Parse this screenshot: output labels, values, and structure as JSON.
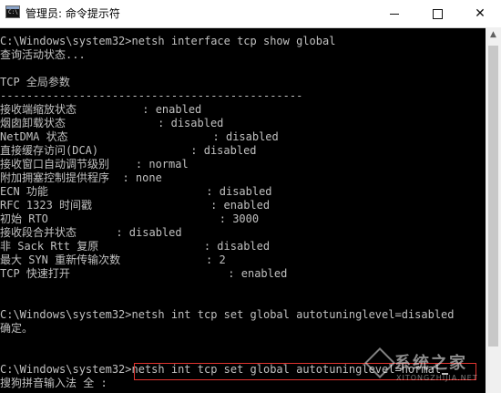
{
  "window": {
    "title": "管理员: 命令提示符",
    "icon_name": "cmd-icon",
    "minimize_icon": "minimize-icon",
    "maximize_icon": "maximize-icon",
    "close_icon": "close-icon",
    "close_glyph": "✕"
  },
  "console_lines": [
    "",
    "C:\\Windows\\system32>netsh interface tcp show global",
    "查询活动状态...",
    "",
    "TCP 全局参数",
    "----------------------------------------------",
    "接收端缩放状态          : enabled",
    "烟囱卸载状态              : disabled",
    "NetDMA 状态                      : disabled",
    "直接缓存访问(DCA)              : disabled",
    "接收窗口自动调节级别    : normal",
    "附加拥塞控制提供程序  : none",
    "ECN 功能                        : disabled",
    "RFC 1323 时间戳                  : enabled",
    "初始 RTO                          : 3000",
    "接收段合并状态      : disabled",
    "非 Sack Rtt 复原                : disabled",
    "最大 SYN 重新传输次数             : 2",
    "TCP 快速打开                        : enabled",
    "",
    "",
    "C:\\Windows\\system32>netsh int tcp set global autotuninglevel=disabled",
    "确定。",
    "",
    "",
    "C:\\Windows\\system32>netsh int tcp set global autotuninglevel=normal",
    "搜狗拼音输入法 全 :"
  ],
  "watermark": {
    "text": "系统之家",
    "sub": "XITONGZHIJIA.NET"
  }
}
